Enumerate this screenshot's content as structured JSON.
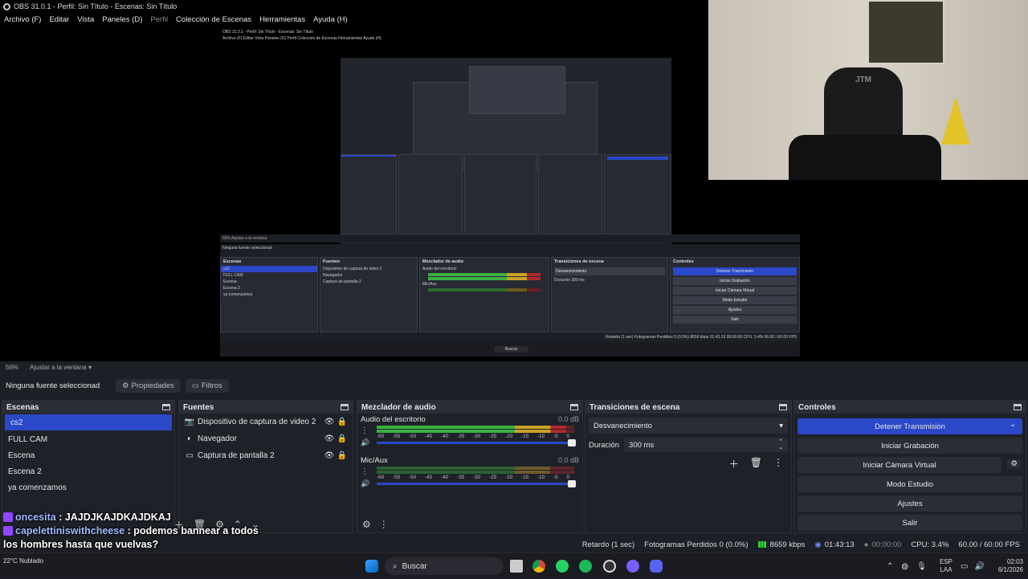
{
  "window": {
    "title": "OBS 31.0.1 - Perfil: Sin Título - Escenas: Sin Título"
  },
  "menu": [
    {
      "label": "Archivo (F)",
      "disabled": false
    },
    {
      "label": "Editar",
      "disabled": false
    },
    {
      "label": "Vista",
      "disabled": false
    },
    {
      "label": "Paneles (D)",
      "disabled": false
    },
    {
      "label": "Perfil",
      "disabled": true
    },
    {
      "label": "Colección de Escenas",
      "disabled": false
    },
    {
      "label": "Herramientas",
      "disabled": false
    },
    {
      "label": "Ayuda (H)",
      "disabled": false
    }
  ],
  "zoom": {
    "percent": "56%",
    "fit_label": "Ajustar a la ventana"
  },
  "source_bar": {
    "no_selection": "Ninguna fuente seleccionad",
    "properties": "Propiedades",
    "filters": "Filtros"
  },
  "scenes": {
    "title": "Escenas",
    "items": [
      "cs2",
      "FULL CAM",
      "Escena",
      "Escena 2",
      "ya comenzamos"
    ],
    "selected_index": 0
  },
  "sources": {
    "title": "Fuentes",
    "items": [
      {
        "name": "Dispositivo de captura de video 2",
        "icon": "camera-icon"
      },
      {
        "name": "Navegador",
        "icon": "globe-icon"
      },
      {
        "name": "Captura de pantalla 2",
        "icon": "monitor-icon"
      }
    ]
  },
  "mixer": {
    "title": "Mezclador de audio",
    "scale": [
      "-60",
      "-55",
      "-50",
      "-45",
      "-40",
      "-35",
      "-30",
      "-25",
      "-20",
      "-15",
      "-10",
      "-5",
      "0"
    ],
    "channels": [
      {
        "name": "Audio del escritorio",
        "db": "0.0 dB",
        "level": 0.96
      },
      {
        "name": "Mic/Aux",
        "db": "0.0 dB",
        "level": 0
      }
    ]
  },
  "transitions": {
    "title": "Transiciones de escena",
    "selected": "Desvanecimiento",
    "duration_label": "Duración",
    "duration_value": "300 ms"
  },
  "controls": {
    "title": "Controles",
    "buttons": [
      "Detener Transmisión",
      "Iniciar Grabación",
      "Iniciar Cámara Virtual",
      "Modo Estudio",
      "Ajustes",
      "Salir"
    ]
  },
  "status": {
    "delay": "Retardo (1 sec)",
    "dropped": "Fotogramas Perdidos 0 (0.0%)",
    "bitrate": "8659 kbps",
    "stream_time": "01:43:13",
    "rec_time": "00:00:00",
    "cpu": "CPU: 3.4%",
    "fps": "60.00 / 60.00 FPS"
  },
  "chat": [
    {
      "user": "oncesita",
      "message": "JAJDJKAJDKAJDKAJ"
    },
    {
      "user": "capelettiniswithcheese",
      "message": "podemos bannear a todos los hombres hasta que vuelvas?"
    }
  ],
  "taskbar": {
    "search_placeholder": "Buscar",
    "weather_temp": "22°C",
    "weather_desc": "Nublado",
    "lang_line1": "ESP",
    "lang_line2": "LAA",
    "time": "02:03",
    "date": "6/1/2026"
  },
  "nested": {
    "title": "OBS 31.0.1 - Perfil: Sin Título - Escenas: Sin Título",
    "menu": "Archivo (F)   Editar   Vista   Paneles (D)   Perfil   Colección de Escenas   Herramientas   Ayuda (H)",
    "zoom": "56%   Ajustar a la ventana",
    "no_selection": "Ninguna fuente seleccionad",
    "scenes_title": "Escenas",
    "sources_title": "Fuentes",
    "mixer_title": "Mezclador de audio",
    "transitions_title": "Transiciones de escena",
    "controls_title": "Controles",
    "transition": "Desvanecimiento",
    "duration": "Duración   300 ms",
    "mixer_ch1": "Audio del escritorio",
    "mixer_ch2": "Mic/Aux",
    "status": "Retardo (1 sec)    Fotogramas Perdidos 0 (0.0%)    8659 kbps   01:43:13   00:00:00   CPU: 3.4%   60.00 / 60.00 FPS",
    "search": "Buscar",
    "webcam_sign": "JTM"
  },
  "colors": {
    "accent": "#2b48c8",
    "meter_green": "#3cb043",
    "meter_yellow": "#c9a227",
    "meter_red": "#b02a2a"
  }
}
